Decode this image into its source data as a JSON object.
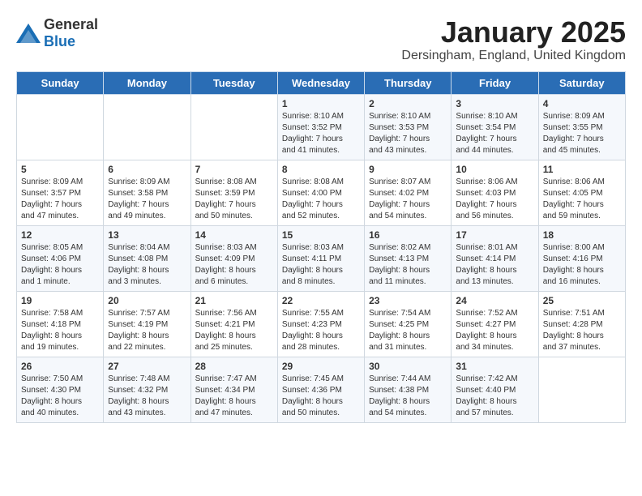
{
  "header": {
    "logo_general": "General",
    "logo_blue": "Blue",
    "month_title": "January 2025",
    "location": "Dersingham, England, United Kingdom"
  },
  "days_of_week": [
    "Sunday",
    "Monday",
    "Tuesday",
    "Wednesday",
    "Thursday",
    "Friday",
    "Saturday"
  ],
  "weeks": [
    [
      {
        "day": "",
        "content": ""
      },
      {
        "day": "",
        "content": ""
      },
      {
        "day": "",
        "content": ""
      },
      {
        "day": "1",
        "content": "Sunrise: 8:10 AM\nSunset: 3:52 PM\nDaylight: 7 hours\nand 41 minutes."
      },
      {
        "day": "2",
        "content": "Sunrise: 8:10 AM\nSunset: 3:53 PM\nDaylight: 7 hours\nand 43 minutes."
      },
      {
        "day": "3",
        "content": "Sunrise: 8:10 AM\nSunset: 3:54 PM\nDaylight: 7 hours\nand 44 minutes."
      },
      {
        "day": "4",
        "content": "Sunrise: 8:09 AM\nSunset: 3:55 PM\nDaylight: 7 hours\nand 45 minutes."
      }
    ],
    [
      {
        "day": "5",
        "content": "Sunrise: 8:09 AM\nSunset: 3:57 PM\nDaylight: 7 hours\nand 47 minutes."
      },
      {
        "day": "6",
        "content": "Sunrise: 8:09 AM\nSunset: 3:58 PM\nDaylight: 7 hours\nand 49 minutes."
      },
      {
        "day": "7",
        "content": "Sunrise: 8:08 AM\nSunset: 3:59 PM\nDaylight: 7 hours\nand 50 minutes."
      },
      {
        "day": "8",
        "content": "Sunrise: 8:08 AM\nSunset: 4:00 PM\nDaylight: 7 hours\nand 52 minutes."
      },
      {
        "day": "9",
        "content": "Sunrise: 8:07 AM\nSunset: 4:02 PM\nDaylight: 7 hours\nand 54 minutes."
      },
      {
        "day": "10",
        "content": "Sunrise: 8:06 AM\nSunset: 4:03 PM\nDaylight: 7 hours\nand 56 minutes."
      },
      {
        "day": "11",
        "content": "Sunrise: 8:06 AM\nSunset: 4:05 PM\nDaylight: 7 hours\nand 59 minutes."
      }
    ],
    [
      {
        "day": "12",
        "content": "Sunrise: 8:05 AM\nSunset: 4:06 PM\nDaylight: 8 hours\nand 1 minute."
      },
      {
        "day": "13",
        "content": "Sunrise: 8:04 AM\nSunset: 4:08 PM\nDaylight: 8 hours\nand 3 minutes."
      },
      {
        "day": "14",
        "content": "Sunrise: 8:03 AM\nSunset: 4:09 PM\nDaylight: 8 hours\nand 6 minutes."
      },
      {
        "day": "15",
        "content": "Sunrise: 8:03 AM\nSunset: 4:11 PM\nDaylight: 8 hours\nand 8 minutes."
      },
      {
        "day": "16",
        "content": "Sunrise: 8:02 AM\nSunset: 4:13 PM\nDaylight: 8 hours\nand 11 minutes."
      },
      {
        "day": "17",
        "content": "Sunrise: 8:01 AM\nSunset: 4:14 PM\nDaylight: 8 hours\nand 13 minutes."
      },
      {
        "day": "18",
        "content": "Sunrise: 8:00 AM\nSunset: 4:16 PM\nDaylight: 8 hours\nand 16 minutes."
      }
    ],
    [
      {
        "day": "19",
        "content": "Sunrise: 7:58 AM\nSunset: 4:18 PM\nDaylight: 8 hours\nand 19 minutes."
      },
      {
        "day": "20",
        "content": "Sunrise: 7:57 AM\nSunset: 4:19 PM\nDaylight: 8 hours\nand 22 minutes."
      },
      {
        "day": "21",
        "content": "Sunrise: 7:56 AM\nSunset: 4:21 PM\nDaylight: 8 hours\nand 25 minutes."
      },
      {
        "day": "22",
        "content": "Sunrise: 7:55 AM\nSunset: 4:23 PM\nDaylight: 8 hours\nand 28 minutes."
      },
      {
        "day": "23",
        "content": "Sunrise: 7:54 AM\nSunset: 4:25 PM\nDaylight: 8 hours\nand 31 minutes."
      },
      {
        "day": "24",
        "content": "Sunrise: 7:52 AM\nSunset: 4:27 PM\nDaylight: 8 hours\nand 34 minutes."
      },
      {
        "day": "25",
        "content": "Sunrise: 7:51 AM\nSunset: 4:28 PM\nDaylight: 8 hours\nand 37 minutes."
      }
    ],
    [
      {
        "day": "26",
        "content": "Sunrise: 7:50 AM\nSunset: 4:30 PM\nDaylight: 8 hours\nand 40 minutes."
      },
      {
        "day": "27",
        "content": "Sunrise: 7:48 AM\nSunset: 4:32 PM\nDaylight: 8 hours\nand 43 minutes."
      },
      {
        "day": "28",
        "content": "Sunrise: 7:47 AM\nSunset: 4:34 PM\nDaylight: 8 hours\nand 47 minutes."
      },
      {
        "day": "29",
        "content": "Sunrise: 7:45 AM\nSunset: 4:36 PM\nDaylight: 8 hours\nand 50 minutes."
      },
      {
        "day": "30",
        "content": "Sunrise: 7:44 AM\nSunset: 4:38 PM\nDaylight: 8 hours\nand 54 minutes."
      },
      {
        "day": "31",
        "content": "Sunrise: 7:42 AM\nSunset: 4:40 PM\nDaylight: 8 hours\nand 57 minutes."
      },
      {
        "day": "",
        "content": ""
      }
    ]
  ]
}
